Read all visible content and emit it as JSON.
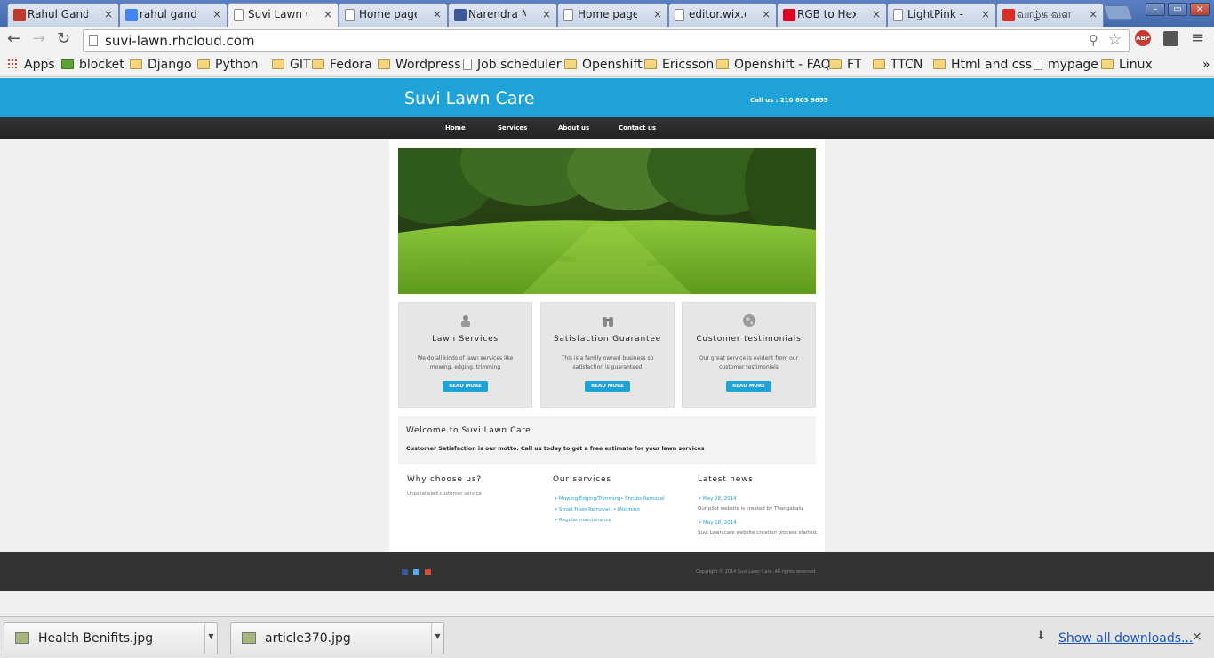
{
  "browser": {
    "tabs": [
      {
        "title": "Rahul Gandhi",
        "favicon_color": "#c0392b"
      },
      {
        "title": "rahul gandhi",
        "favicon_color": "#4285f4"
      },
      {
        "title": "Suvi Lawn Ca",
        "favicon_color": "#ffffff"
      },
      {
        "title": "Home page",
        "favicon_color": "#ffffff"
      },
      {
        "title": "Narendra MO",
        "favicon_color": "#3b5998"
      },
      {
        "title": "Home page",
        "favicon_color": "#ffffff"
      },
      {
        "title": "editor.wix.co",
        "favicon_color": "#ffffff"
      },
      {
        "title": "RGB to Hexa",
        "favicon_color": "#e00020"
      },
      {
        "title": "LightPink - #",
        "favicon_color": "#ffffff"
      },
      {
        "title": "வாழ்க வள",
        "favicon_color": "#d93025"
      }
    ],
    "tab_close": "×",
    "win_minimize": "–",
    "win_restore": "▭",
    "win_close": "×",
    "back": "←",
    "forward": "→",
    "reload": "↻",
    "url": "suvi-lawn.rhcloud.com",
    "abp_label": "ABP",
    "menu_icon": "≡",
    "bookmarks": [
      {
        "label": "Apps",
        "kind": "apps"
      },
      {
        "label": "blocket",
        "kind": "site"
      },
      {
        "label": "Django",
        "kind": "folder"
      },
      {
        "label": "Python",
        "kind": "folder"
      },
      {
        "label": "GIT",
        "kind": "folder"
      },
      {
        "label": "Fedora",
        "kind": "folder"
      },
      {
        "label": "Wordpress",
        "kind": "folder"
      },
      {
        "label": "Job scheduler",
        "kind": "page"
      },
      {
        "label": "Openshift",
        "kind": "folder"
      },
      {
        "label": "Ericsson",
        "kind": "folder"
      },
      {
        "label": "Openshift - FAQ",
        "kind": "folder"
      },
      {
        "label": "FT",
        "kind": "folder"
      },
      {
        "label": "TTCN",
        "kind": "folder"
      },
      {
        "label": "Html and css",
        "kind": "folder"
      },
      {
        "label": "mypage",
        "kind": "page"
      },
      {
        "label": "Linux",
        "kind": "folder"
      }
    ],
    "bookmarks_more": "»"
  },
  "site": {
    "title": "Suvi Lawn Care",
    "call_us": "Call us : 210 803 9655",
    "nav": [
      "Home",
      "Services",
      "About us",
      "Contact us"
    ],
    "features": [
      {
        "icon": "person-icon",
        "title": "Lawn Services",
        "body": "We do all kinds of lawn services like mowing, edging, trimming",
        "button": "READ MORE"
      },
      {
        "icon": "binoculars-icon",
        "title": "Satisfaction Guarantee",
        "body": "This is a family owned business so satisfaction is guaranteed",
        "button": "READ MORE"
      },
      {
        "icon": "globe-icon",
        "title": "Customer testimonials",
        "body": "Our great service is evident from our customer testimonials",
        "button": "READ MORE"
      }
    ],
    "welcome": {
      "title": "Welcome to Suvi Lawn Care",
      "body": "Customer Satisfaction is our motto. Call us today to get a free estimate for your lawn services"
    },
    "why": {
      "title": "Why choose us?",
      "body": "Unparalleled customer service"
    },
    "services": {
      "title": "Our services",
      "items": [
        "Mowing/Edging/Trimming",
        "Shrubs Removal",
        "Small Trees Removal",
        "Mulching",
        "Regular maintenance"
      ]
    },
    "news": {
      "title": "Latest news",
      "items": [
        {
          "date": "May 28, 2014",
          "text": "Our pilot website is created by Thangabalu"
        },
        {
          "date": "May 18, 2014",
          "text": "Suvi Lawn care website creation process started."
        }
      ]
    },
    "footer": {
      "social": [
        {
          "name": "facebook-icon",
          "color": "#3b5998"
        },
        {
          "name": "twitter-icon",
          "color": "#55acee"
        },
        {
          "name": "google-plus-icon",
          "color": "#dd4b39"
        }
      ],
      "copyright": "Copyright © 2014 Suvi Lawn Care. All rights reserved."
    },
    "accent_color": "#1fa2d8"
  },
  "downloads": {
    "items": [
      "Health Benifits.jpg",
      "article370.jpg"
    ],
    "show_all": "Show all downloads...",
    "close": "×"
  }
}
